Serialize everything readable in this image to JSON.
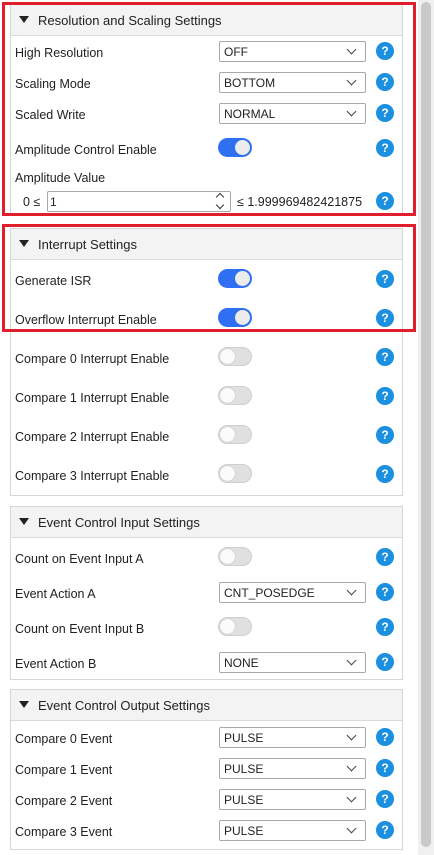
{
  "sections": {
    "resolution": {
      "title": "Resolution and Scaling Settings",
      "high_resolution": {
        "label": "High Resolution",
        "value": "OFF"
      },
      "scaling_mode": {
        "label": "Scaling Mode",
        "value": "BOTTOM"
      },
      "scaled_write": {
        "label": "Scaled Write",
        "value": "NORMAL"
      },
      "amplitude_control": {
        "label": "Amplitude Control Enable",
        "state": "on"
      },
      "amplitude_value": {
        "label": "Amplitude Value",
        "min_label": "0 ≤",
        "value": "1",
        "max_label": "≤ 1.999969482421875"
      }
    },
    "interrupt": {
      "title": "Interrupt Settings",
      "generate_isr": {
        "label": "Generate ISR",
        "state": "on"
      },
      "overflow": {
        "label": "Overflow Interrupt Enable",
        "state": "on"
      },
      "compare0": {
        "label": "Compare 0 Interrupt Enable",
        "state": "off"
      },
      "compare1": {
        "label": "Compare 1 Interrupt Enable",
        "state": "off"
      },
      "compare2": {
        "label": "Compare 2 Interrupt Enable",
        "state": "off"
      },
      "compare3": {
        "label": "Compare 3 Interrupt Enable",
        "state": "off"
      }
    },
    "event_input": {
      "title": "Event Control Input Settings",
      "count_a": {
        "label": "Count on Event Input A",
        "state": "off"
      },
      "action_a": {
        "label": "Event Action A",
        "value": "CNT_POSEDGE"
      },
      "count_b": {
        "label": "Count on Event Input B",
        "state": "off"
      },
      "action_b": {
        "label": "Event Action B",
        "value": "NONE"
      }
    },
    "event_output": {
      "title": "Event Control Output Settings",
      "compare0": {
        "label": "Compare 0 Event",
        "value": "PULSE"
      },
      "compare1": {
        "label": "Compare 1 Event",
        "value": "PULSE"
      },
      "compare2": {
        "label": "Compare 2 Event",
        "value": "PULSE"
      },
      "compare3": {
        "label": "Compare 3 Event",
        "value": "PULSE"
      }
    }
  },
  "help_glyph": "?",
  "icons": {
    "collapse": "triangle-down-icon",
    "help": "help-icon",
    "dropdown": "chevron-down-icon"
  },
  "colors": {
    "accent": "#2f6ff1",
    "help": "#1b8fe0",
    "highlight": "#e01e2c",
    "header_bg": "#f3f3f3"
  }
}
